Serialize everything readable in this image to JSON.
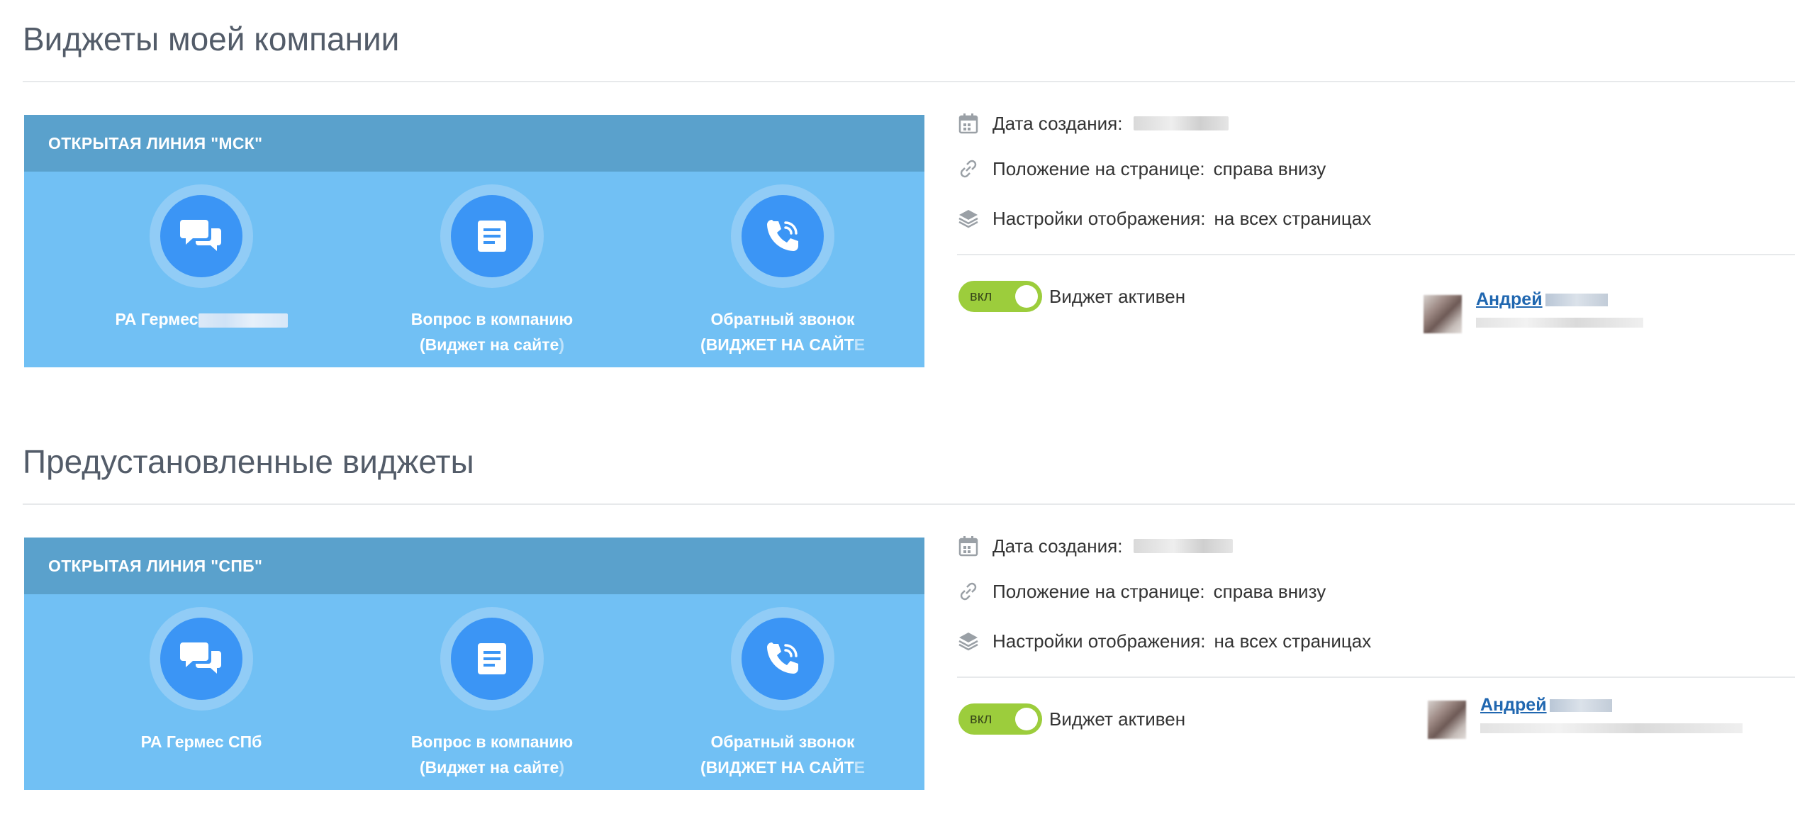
{
  "sections": [
    {
      "title": "Виджеты моей компании",
      "widget": {
        "header": "ОТКРЫТАЯ ЛИНИЯ \"МСК\"",
        "channels": [
          {
            "icon": "chat-icon",
            "line1": "РА Гермес",
            "line2": ""
          },
          {
            "icon": "form-icon",
            "line1": "Вопрос в компанию",
            "line2": "(Виджет на сайте",
            "line2_tail": ")"
          },
          {
            "icon": "phone-icon",
            "line1": "Обратный звонок",
            "line2": "(ВИДЖЕТ НА САЙТ",
            "line2_tail": "Е"
          }
        ]
      },
      "info": {
        "created_label": "Дата создания:",
        "position_label": "Положение на странице:",
        "position_value": "справа внизу",
        "display_label": "Настройки отображения:",
        "display_value": "на всех страницах",
        "toggle_label": "вкл",
        "active_text": "Виджет активен",
        "user_name": "Андрей"
      }
    },
    {
      "title": "Предустановленные виджеты",
      "widget": {
        "header": "ОТКРЫТАЯ ЛИНИЯ \"СПБ\"",
        "channels": [
          {
            "icon": "chat-icon",
            "line1": "РА Гермес СПб",
            "line2": ""
          },
          {
            "icon": "form-icon",
            "line1": "Вопрос в компанию",
            "line2": "(Виджет на сайте",
            "line2_tail": ")"
          },
          {
            "icon": "phone-icon",
            "line1": "Обратный звонок",
            "line2": "(ВИДЖЕТ НА САЙТ",
            "line2_tail": "Е"
          }
        ]
      },
      "info": {
        "created_label": "Дата создания:",
        "position_label": "Положение на странице:",
        "position_value": "справа внизу",
        "display_label": "Настройки отображения:",
        "display_value": "на всех страницах",
        "toggle_label": "вкл",
        "active_text": "Виджет активен",
        "user_name": "Андрей"
      }
    }
  ],
  "colors": {
    "card_header": "#5aa1cc",
    "card_body": "#71c0f4",
    "icon_circle": "#3b95f5",
    "toggle_on": "#9ccd3c",
    "link": "#2067b0",
    "title": "#535c69"
  }
}
